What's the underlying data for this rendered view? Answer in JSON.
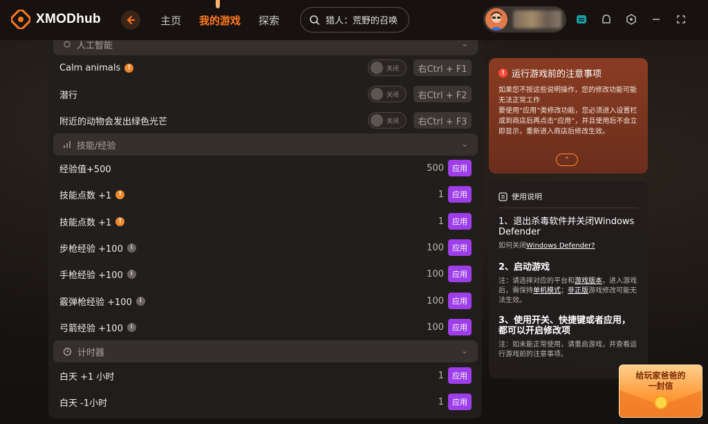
{
  "app": {
    "name": "XMODhub"
  },
  "nav": {
    "items": [
      "主页",
      "我的游戏",
      "探索"
    ],
    "active": "我的游戏"
  },
  "search": {
    "value": "猎人：荒野的召唤"
  },
  "user": {
    "avatar": "avatar-icon"
  },
  "sections": {
    "ai": {
      "title": "人工智能"
    },
    "skills": {
      "title": "技能/经验"
    },
    "timer": {
      "title": "计时器"
    }
  },
  "toggle_off_label": "关闭",
  "apply_label": "应用",
  "ai_rows": [
    {
      "name": "Calm animals",
      "hotkey": "右Ctrl + F1",
      "info": "orange"
    },
    {
      "name": "潜行",
      "hotkey": "右Ctrl + F2"
    },
    {
      "name": "附近的动物会发出绿色光芒",
      "hotkey": "右Ctrl + F3"
    }
  ],
  "skill_rows": [
    {
      "name": "经验值+500",
      "value": "500"
    },
    {
      "name": "技能点数 +1",
      "value": "1",
      "info": "orange"
    },
    {
      "name": "技能点数 +1",
      "value": "1",
      "info": "orange"
    },
    {
      "name": "步枪经验 +100",
      "value": "100",
      "info": "gray"
    },
    {
      "name": "手枪经验 +100",
      "value": "100",
      "info": "gray"
    },
    {
      "name": "霰弹枪经验 +100",
      "value": "100",
      "info": "gray"
    },
    {
      "name": "弓箭经验 +100",
      "value": "100",
      "info": "gray"
    }
  ],
  "timer_rows": [
    {
      "name": "白天 +1 小时",
      "value": "1"
    },
    {
      "name": "白天 -1小时",
      "value": "1"
    }
  ],
  "notice": {
    "title": "运行游戏前的注意事项",
    "lines": [
      "如果您不按这些说明操作，您的修改功能可能无法正常工作",
      "要使用“应用”类修改功能，您必须进入设置栏或到商店后再点击“应用”，并且使用后不会立即显示，重新进入商店后修改生效。"
    ]
  },
  "guide": {
    "title": "使用说明",
    "step1_title": "1、退出杀毒软件并关闭Windows Defender",
    "step1_text_prefix": "如何关闭",
    "step1_link": "Windows Defender?",
    "step2_title": "2、启动游戏",
    "step2_text_a": "注：请选择对应的平台和",
    "step2_link_a": "游戏版本",
    "step2_text_b": "，进入游戏后，需保持",
    "step2_link_b": "单机模式",
    "step2_text_c": "；",
    "step2_link_c": "非正版",
    "step2_text_d": "游戏修改可能无法生效。",
    "step3_title": "3、使用开关、快捷键或者应用，都可以开启修改项",
    "step3_text": "注：如未能正常使用，请重启游戏，并查看运行游戏前的注意事项。"
  },
  "letter": {
    "line1": "给玩家爸爸的",
    "line2": "一封信"
  },
  "colors": {
    "accent": "#ff7a1a",
    "apply": "#9d3ee8",
    "notice": "#8a3c22"
  }
}
